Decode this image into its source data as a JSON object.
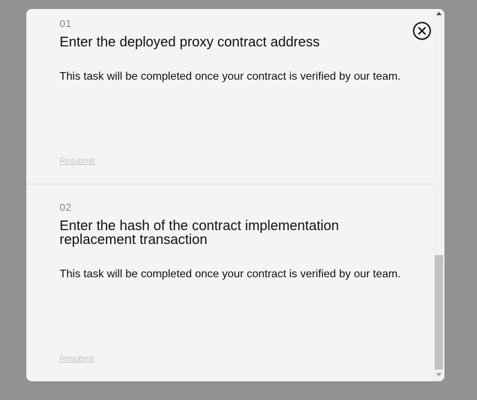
{
  "tasks": [
    {
      "number": "01",
      "title": "Enter the deployed proxy contract address",
      "description": "This task will be completed once your contract is verified by our team.",
      "action_label": "Resubmit"
    },
    {
      "number": "02",
      "title": "Enter the hash of the contract implementation replacement transaction",
      "description": "This task will be completed once your contract is verified by our team.",
      "action_label": "Resubmit"
    }
  ],
  "close_icon": "close-circle-icon",
  "colors": {
    "overlay": "#929292",
    "modal_bg": "#f4f4f4",
    "text": "#111111",
    "muted": "#8a8a8a",
    "link_disabled": "#c3c3c3"
  }
}
